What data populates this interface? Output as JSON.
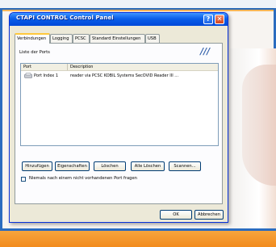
{
  "window": {
    "title": "CTAPI CONTROL Control Panel",
    "help_label": "?",
    "close_label": "✕"
  },
  "tabs": [
    {
      "label": "Verbindungen",
      "active": true
    },
    {
      "label": "Logging",
      "active": false
    },
    {
      "label": "PCSC",
      "active": false
    },
    {
      "label": "Standard Einstellungen",
      "active": false
    },
    {
      "label": "USB",
      "active": false
    }
  ],
  "ports": {
    "section_label": "Liste der Ports",
    "columns": [
      "Port",
      "Description"
    ],
    "rows": [
      {
        "icon": "card-reader-icon",
        "port": "Port Index 1",
        "description": "reader via PCSC KOBIL Systems SecOVID Reader III ..."
      }
    ]
  },
  "buttons": {
    "add": "Hinzufügen",
    "properties": "Eigenschaften",
    "delete": "Löschen",
    "delete_all": "Alle Löschen",
    "scan": "Scannen..."
  },
  "options": {
    "never_ask_label": "Niemals nach einem nicht vorhandenen Port fragen",
    "never_ask_checked": false
  },
  "footer": {
    "ok": "OK",
    "cancel": "Abbrechen"
  },
  "colors": {
    "titlebar": "#0a5ee9",
    "accent_orange": "#f28b1e",
    "frame_blue": "#2b6cbf"
  },
  "logo": {
    "glyph": "///",
    "icon": "kobil-logo-icon"
  }
}
